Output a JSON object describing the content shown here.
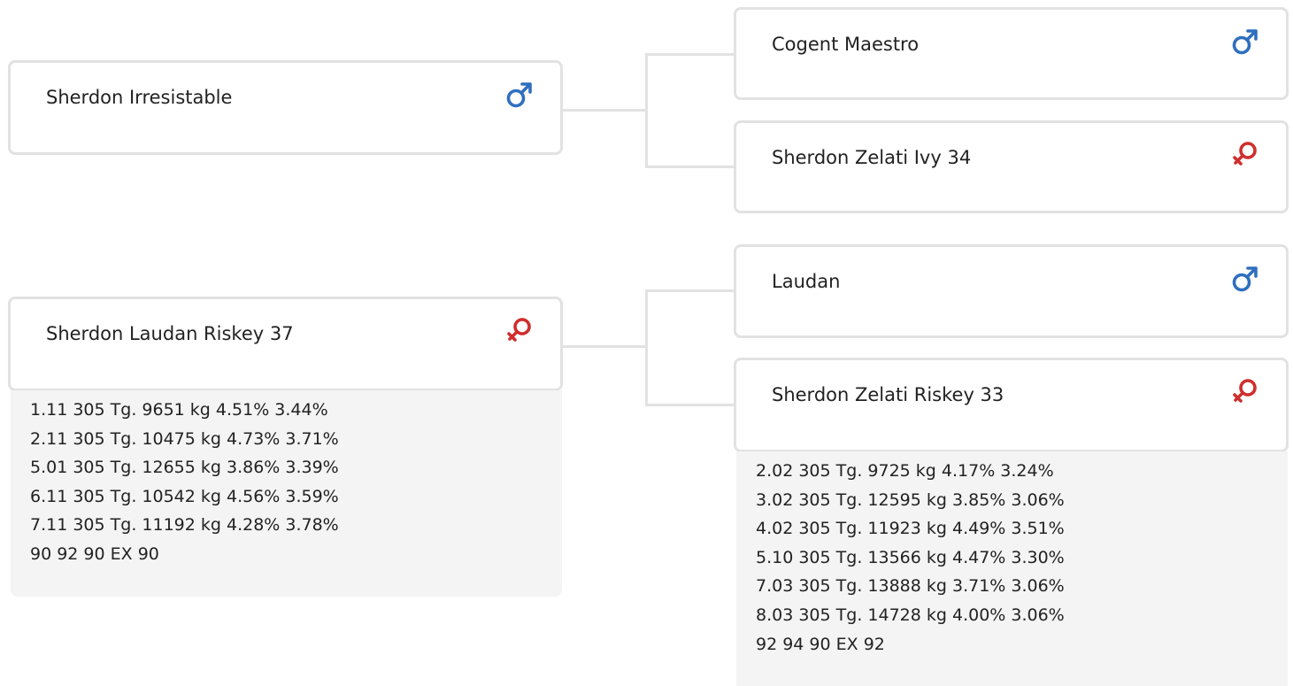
{
  "colors": {
    "male": "#2f6fbf",
    "female": "#cf2e2e",
    "border": "#e2e2e2",
    "stats_bg": "#f4f4f4"
  },
  "parents": [
    {
      "name": "Sherdon Irresistable",
      "sex": "male",
      "sex_icon": "male-icon",
      "stats": []
    },
    {
      "name": "Sherdon Laudan Riskey 37",
      "sex": "female",
      "sex_icon": "female-icon",
      "stats": [
        "1.11 305 Tg. 9651 kg 4.51% 3.44%",
        "2.11 305 Tg. 10475 kg 4.73% 3.71%",
        "5.01 305 Tg. 12655 kg 3.86% 3.39%",
        "6.11 305 Tg. 10542 kg 4.56% 3.59%",
        "7.11 305 Tg. 11192 kg 4.28% 3.78%",
        "90 92 90 EX 90"
      ]
    }
  ],
  "grandparents": [
    {
      "name": "Cogent Maestro",
      "sex": "male",
      "sex_icon": "male-icon",
      "stats": []
    },
    {
      "name": "Sherdon Zelati Ivy 34",
      "sex": "female",
      "sex_icon": "female-icon",
      "stats": []
    },
    {
      "name": "Laudan",
      "sex": "male",
      "sex_icon": "male-icon",
      "stats": []
    },
    {
      "name": "Sherdon Zelati Riskey 33",
      "sex": "female",
      "sex_icon": "female-icon",
      "stats": [
        "2.02 305 Tg. 9725 kg 4.17% 3.24%",
        "3.02 305 Tg. 12595 kg 3.85% 3.06%",
        "4.02 305 Tg. 11923 kg 4.49% 3.51%",
        "5.10 305 Tg. 13566 kg 4.47% 3.30%",
        "7.03 305 Tg. 13888 kg 3.71% 3.06%",
        "8.03 305 Tg. 14728 kg 4.00% 3.06%",
        "92 94 90 EX 92"
      ]
    }
  ]
}
